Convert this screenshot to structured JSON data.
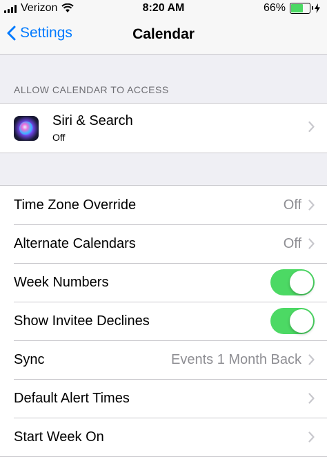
{
  "status_bar": {
    "carrier": "Verizon",
    "time": "8:20 AM",
    "battery_percent": "66%",
    "battery_level": 0.66
  },
  "nav": {
    "back_label": "Settings",
    "title": "Calendar"
  },
  "access_section": {
    "header": "ALLOW CALENDAR TO ACCESS",
    "siri": {
      "title": "Siri & Search",
      "subtitle": "Off"
    }
  },
  "settings": {
    "time_zone": {
      "label": "Time Zone Override",
      "value": "Off"
    },
    "alternate": {
      "label": "Alternate Calendars",
      "value": "Off"
    },
    "week_numbers": {
      "label": "Week Numbers",
      "on": true
    },
    "invitee_declines": {
      "label": "Show Invitee Declines",
      "on": true
    },
    "sync": {
      "label": "Sync",
      "value": "Events 1 Month Back"
    },
    "alert_times": {
      "label": "Default Alert Times"
    },
    "start_week": {
      "label": "Start Week On"
    }
  },
  "colors": {
    "accent": "#007aff",
    "toggle_on": "#4cd964",
    "background": "#efeff4"
  }
}
